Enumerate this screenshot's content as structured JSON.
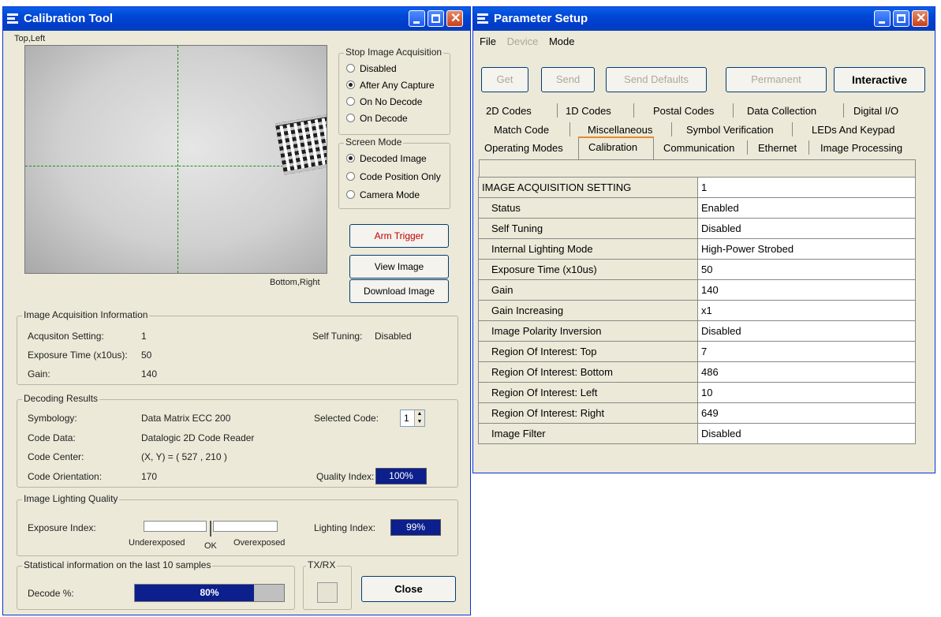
{
  "calib": {
    "title": "Calibration Tool",
    "corner_top_left": "Top,Left",
    "corner_bottom_right": "Bottom,Right",
    "stop_acq": {
      "title": "Stop Image Acquisition",
      "options": [
        "Disabled",
        "After Any Capture",
        "On No Decode",
        "On Decode"
      ],
      "selected": "After Any Capture"
    },
    "screen_mode": {
      "title": "Screen Mode",
      "options": [
        "Decoded Image",
        "Code Position Only",
        "Camera Mode"
      ],
      "selected": "Decoded Image"
    },
    "buttons": {
      "arm": "Arm Trigger",
      "view": "View Image",
      "download": "Download Image",
      "close": "Close"
    },
    "acq_info": {
      "title": "Image Acquisition Information",
      "setting_label": "Acqusiton Setting:",
      "setting_value": "1",
      "self_tuning_label": "Self Tuning:",
      "self_tuning_value": "Disabled",
      "exposure_label": "Exposure Time (x10us):",
      "exposure_value": "50",
      "gain_label": "Gain:",
      "gain_value": "140"
    },
    "decoding": {
      "title": "Decoding Results",
      "symbology_label": "Symbology:",
      "symbology_value": "Data Matrix ECC 200",
      "selected_code_label": "Selected Code:",
      "selected_code_value": "1",
      "code_data_label": "Code Data:",
      "code_data_value": "Datalogic 2D Code Reader",
      "code_center_label": "Code Center:",
      "code_center_value": "(X, Y) = ( 527 , 210 )",
      "orientation_label": "Code Orientation:",
      "orientation_value": "170",
      "quality_label": "Quality Index:",
      "quality_value": "100%"
    },
    "lighting": {
      "title": "Image Lighting Quality",
      "exposure_index_label": "Exposure Index:",
      "under": "Underexposed",
      "ok": "OK",
      "over": "Overexposed",
      "lighting_index_label": "Lighting Index:",
      "lighting_index_value": "99%"
    },
    "stats": {
      "title": "Statistical information on the last 10 samples",
      "decode_label": "Decode %:",
      "decode_value": "80%",
      "decode_fraction": 0.8
    },
    "txrx_title": "TX/RX"
  },
  "param": {
    "title": "Parameter Setup",
    "menu": [
      "File",
      "Device",
      "Mode"
    ],
    "toolbar": {
      "get": "Get",
      "send": "Send",
      "send_defaults": "Send Defaults",
      "permanent": "Permanent",
      "interactive": "Interactive"
    },
    "tabs_row1": [
      "2D Codes",
      "1D Codes",
      "Postal Codes",
      "Data Collection",
      "Digital I/O"
    ],
    "tabs_row2": [
      "Match Code",
      "Miscellaneous",
      "Symbol Verification",
      "LEDs And Keypad"
    ],
    "tabs_row3": [
      "Operating Modes",
      "Calibration",
      "Communication",
      "Ethernet",
      "Image Processing"
    ],
    "rows": [
      {
        "k": "IMAGE ACQUISITION SETTING",
        "v": "1"
      },
      {
        "k": "Status",
        "v": "Enabled"
      },
      {
        "k": "Self Tuning",
        "v": "Disabled"
      },
      {
        "k": "Internal Lighting Mode",
        "v": "High-Power Strobed"
      },
      {
        "k": "Exposure Time (x10us)",
        "v": "50"
      },
      {
        "k": "Gain",
        "v": "140"
      },
      {
        "k": "Gain Increasing",
        "v": "x1"
      },
      {
        "k": "Image Polarity Inversion",
        "v": "Disabled"
      },
      {
        "k": "Region Of Interest: Top",
        "v": "7"
      },
      {
        "k": "Region Of Interest: Bottom",
        "v": "486"
      },
      {
        "k": "Region Of Interest: Left",
        "v": "10"
      },
      {
        "k": "Region Of Interest: Right",
        "v": "649"
      },
      {
        "k": "Image Filter",
        "v": "Disabled"
      }
    ]
  },
  "colors": {
    "titlebar": "#0046d5",
    "badge": "#0c1f8c",
    "progress": "#0c1f8c",
    "arm_text": "#c00000"
  },
  "icons": [
    "app-icon",
    "minimize-icon",
    "maximize-icon",
    "close-icon",
    "spinner-up-icon",
    "spinner-down-icon"
  ]
}
